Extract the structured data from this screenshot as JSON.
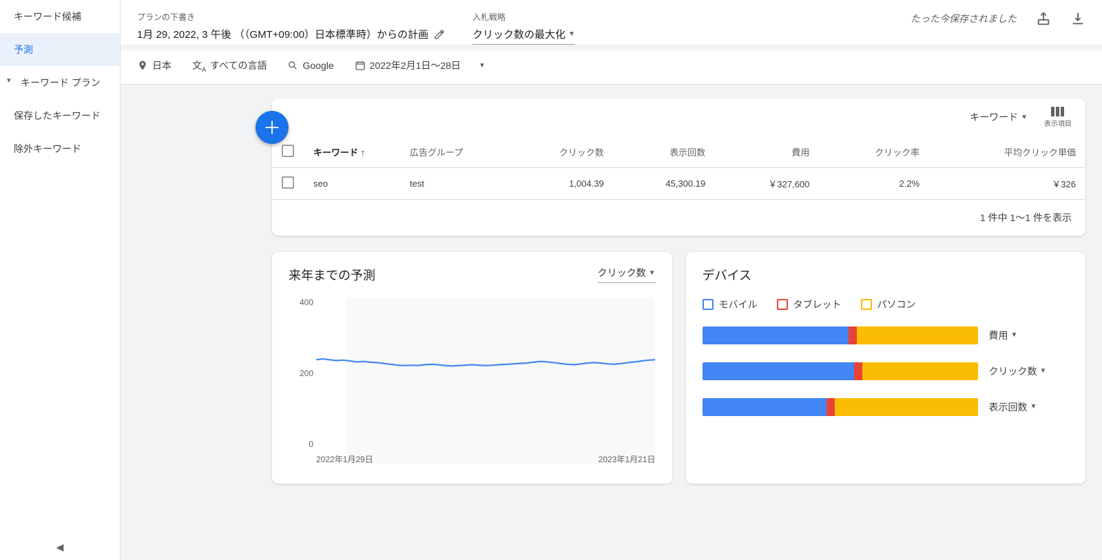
{
  "sidebar": {
    "items": [
      {
        "label": "キーワード候補"
      },
      {
        "label": "予測"
      },
      {
        "label": "キーワード プラン"
      },
      {
        "label": "保存したキーワード"
      },
      {
        "label": "除外キーワード"
      }
    ]
  },
  "topbar": {
    "plan_draft_label": "プランの下書き",
    "plan_date_text": "1月 29, 2022, 3 午後 （（GMT+09:00）日本標準時）からの計画",
    "bid_strategy_label": "入札戦略",
    "bid_strategy_value": "クリック数の最大化",
    "saved_text": "たった今保存されました"
  },
  "filters": {
    "location": "日本",
    "language": "すべての言語",
    "network": "Google",
    "daterange": "2022年2月1日～28日"
  },
  "table": {
    "segment_label": "キーワード",
    "columns_label": "表示項目",
    "headers": {
      "keyword": "キーワード",
      "adgroup": "広告グループ",
      "clicks": "クリック数",
      "impressions": "表示回数",
      "cost": "費用",
      "ctr": "クリック率",
      "cpc": "平均クリック単価"
    },
    "rows": [
      {
        "keyword": "seo",
        "adgroup": "test",
        "clicks": "1,004.39",
        "impressions": "45,300.19",
        "cost": "￥327,600",
        "ctr": "2.2%",
        "cpc": "￥326"
      }
    ],
    "footer": "1 件中 1～1 件を表示"
  },
  "forecast_panel": {
    "title": "来年までの予測",
    "metric": "クリック数"
  },
  "device_panel": {
    "title": "デバイス",
    "legend": {
      "mobile": "モバイル",
      "tablet": "タブレット",
      "desktop": "パソコン"
    },
    "metrics": {
      "cost": "費用",
      "clicks": "クリック数",
      "impressions": "表示回数"
    },
    "colors": {
      "mobile": "#4285f4",
      "tablet": "#ea4335",
      "desktop": "#fbbc04"
    }
  },
  "chart_data": {
    "type": "line",
    "title": "来年までの予測",
    "xlabel": "",
    "ylabel": "",
    "ylim": [
      0,
      400
    ],
    "y_ticks": [
      0,
      200,
      400
    ],
    "x_ticks": [
      "2022年1月29日",
      "2023年1月21日"
    ],
    "series": [
      {
        "name": "クリック数",
        "color": "#4285f4",
        "x": [
          0,
          0.02,
          0.04,
          0.06,
          0.08,
          0.1,
          0.12,
          0.14,
          0.16,
          0.18,
          0.2,
          0.22,
          0.24,
          0.26,
          0.28,
          0.3,
          0.32,
          0.34,
          0.36,
          0.38,
          0.4,
          0.42,
          0.44,
          0.46,
          0.48,
          0.5,
          0.52,
          0.54,
          0.56,
          0.58,
          0.6,
          0.62,
          0.64,
          0.66,
          0.68,
          0.7,
          0.72,
          0.74,
          0.76,
          0.78,
          0.8,
          0.82,
          0.84,
          0.86,
          0.88,
          0.9,
          0.92,
          0.94,
          0.96,
          0.98,
          1.0
        ],
        "y": [
          250,
          252,
          250,
          248,
          249,
          247,
          245,
          246,
          244,
          243,
          241,
          239,
          237,
          236,
          237,
          236,
          238,
          239,
          238,
          236,
          235,
          236,
          237,
          238,
          237,
          236,
          237,
          238,
          239,
          240,
          241,
          242,
          244,
          246,
          245,
          243,
          241,
          239,
          238,
          240,
          242,
          243,
          242,
          240,
          239,
          241,
          243,
          245,
          247,
          249,
          250
        ]
      }
    ],
    "devices_stacked": {
      "type": "stacked-bar-horizontal",
      "categories": [
        "費用",
        "クリック数",
        "表示回数"
      ],
      "series": [
        {
          "name": "モバイル",
          "color": "#4285f4",
          "values": [
            53,
            55,
            45
          ]
        },
        {
          "name": "タブレット",
          "color": "#ea4335",
          "values": [
            3,
            3,
            3
          ]
        },
        {
          "name": "パソコン",
          "color": "#fbbc04",
          "values": [
            44,
            42,
            52
          ]
        }
      ]
    }
  }
}
